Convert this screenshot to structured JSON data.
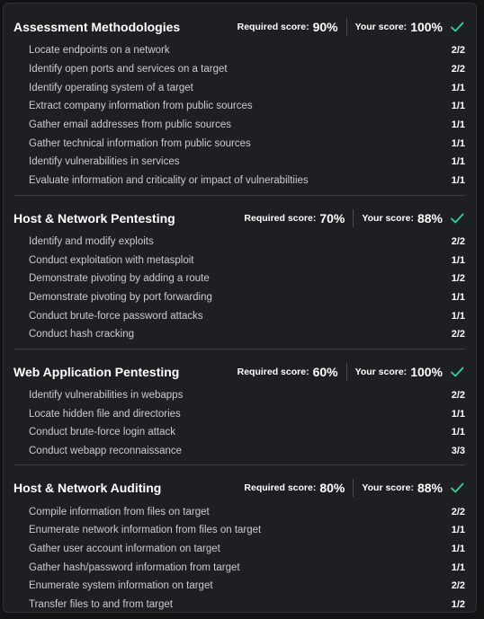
{
  "colors": {
    "accent_check": "#36d399",
    "panel_bg": "#1e1f22",
    "text_primary": "#ffffff",
    "text_secondary": "#c9ccd1"
  },
  "sections": [
    {
      "title": "Assessment Methodologies",
      "required_label": "Required score:",
      "required_value": "90%",
      "your_label": "Your score:",
      "your_value": "100%",
      "status_icon": "check-icon",
      "items": [
        {
          "name": "Locate endpoints on a network",
          "score": "2/2"
        },
        {
          "name": "Identify open ports and services on a target",
          "score": "2/2"
        },
        {
          "name": "Identify operating system of a target",
          "score": "1/1"
        },
        {
          "name": "Extract company information from public sources",
          "score": "1/1"
        },
        {
          "name": "Gather email addresses from public sources",
          "score": "1/1"
        },
        {
          "name": "Gather technical information from public sources",
          "score": "1/1"
        },
        {
          "name": "Identify vulnerabilities in services",
          "score": "1/1"
        },
        {
          "name": "Evaluate information and criticality or impact of vulnerabiltiies",
          "score": "1/1"
        }
      ]
    },
    {
      "title": "Host & Network Pentesting",
      "required_label": "Required score:",
      "required_value": "70%",
      "your_label": "Your score:",
      "your_value": "88%",
      "status_icon": "check-icon",
      "items": [
        {
          "name": "Identify and modify exploits",
          "score": "2/2"
        },
        {
          "name": "Conduct exploitation with metasploit",
          "score": "1/1"
        },
        {
          "name": "Demonstrate pivoting by adding a route",
          "score": "1/2"
        },
        {
          "name": "Demonstrate pivoting by port forwarding",
          "score": "1/1"
        },
        {
          "name": "Conduct brute-force password attacks",
          "score": "1/1"
        },
        {
          "name": "Conduct hash cracking",
          "score": "2/2"
        }
      ]
    },
    {
      "title": "Web Application Pentesting",
      "required_label": "Required score:",
      "required_value": "60%",
      "your_label": "Your score:",
      "your_value": "100%",
      "status_icon": "check-icon",
      "items": [
        {
          "name": "Identify vulnerabilities in webapps",
          "score": "2/2"
        },
        {
          "name": "Locate hidden file and directories",
          "score": "1/1"
        },
        {
          "name": "Conduct brute-force login attack",
          "score": "1/1"
        },
        {
          "name": "Conduct webapp reconnaissance",
          "score": "3/3"
        }
      ]
    },
    {
      "title": "Host & Network Auditing",
      "required_label": "Required score:",
      "required_value": "80%",
      "your_label": "Your score:",
      "your_value": "88%",
      "status_icon": "check-icon",
      "items": [
        {
          "name": "Compile information from files on target",
          "score": "2/2"
        },
        {
          "name": "Enumerate network information from files on target",
          "score": "1/1"
        },
        {
          "name": "Gather user account information on target",
          "score": "1/1"
        },
        {
          "name": "Gather hash/password information from target",
          "score": "1/1"
        },
        {
          "name": "Enumerate system information on target",
          "score": "2/2"
        },
        {
          "name": "Transfer files to and from target",
          "score": "1/2"
        }
      ]
    }
  ]
}
